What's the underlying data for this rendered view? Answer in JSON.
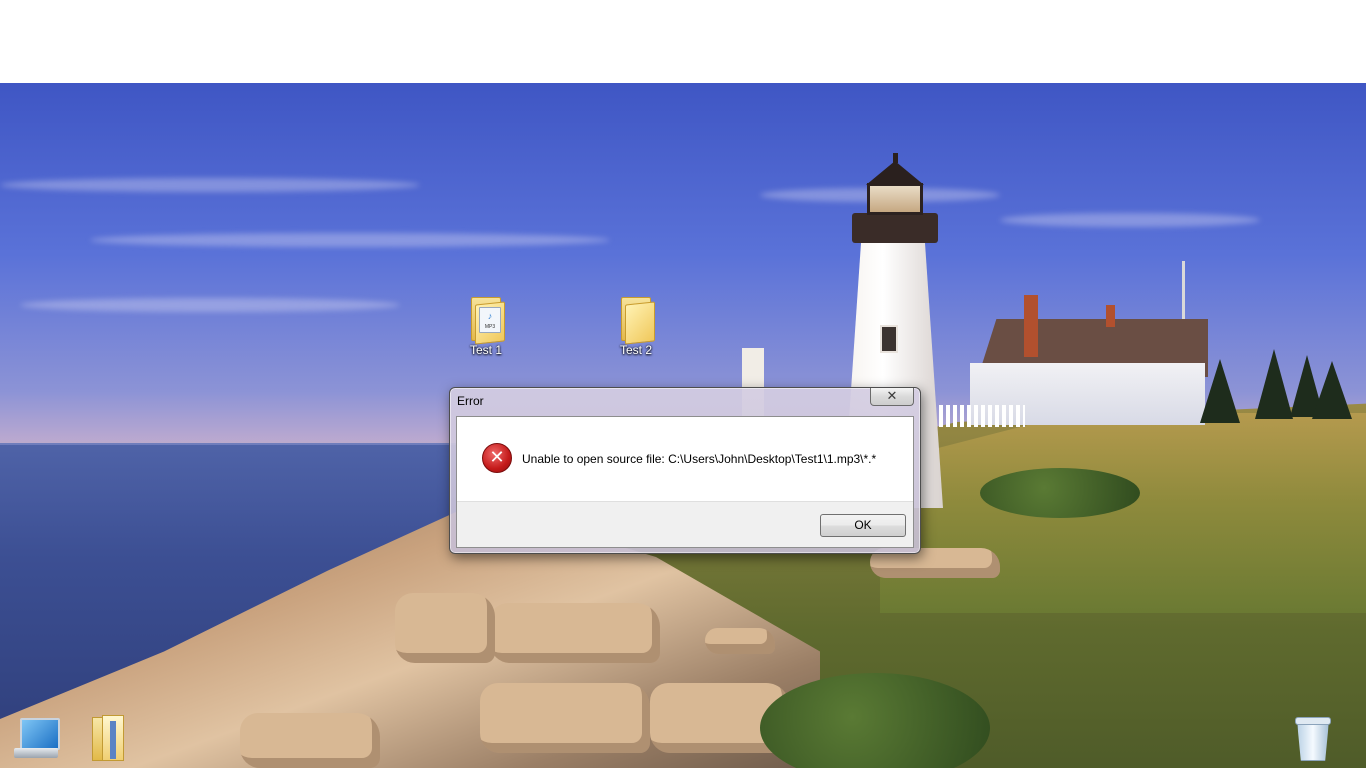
{
  "desktop": {
    "icons": [
      {
        "label": "Test 1",
        "badge": "MP3",
        "glyph": "♪"
      },
      {
        "label": "Test 2"
      }
    ],
    "taskbar_icons": [
      "computer-icon",
      "libraries-icon",
      "recycle-bin-icon"
    ]
  },
  "dialog": {
    "title": "Error",
    "close_glyph": "✕",
    "error_glyph": "✕",
    "message": "Unable to open source file: C:\\Users\\John\\Desktop\\Test1\\1.mp3\\*.*",
    "ok_label": "OK"
  },
  "colors": {
    "error_red": "#c41a1a",
    "dialog_frame": "#c6bed4",
    "button_area": "#f0f0f0"
  }
}
